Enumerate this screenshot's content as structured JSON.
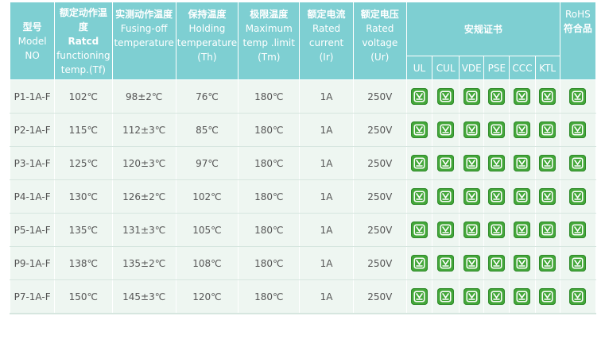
{
  "header": {
    "model": {
      "zh": "型号",
      "en1": "Model",
      "en2": "NO"
    },
    "tf": {
      "zh": "额定动作温度",
      "bold": "Ratcd",
      "en1": "functioning",
      "en2": "temp.(Tf)"
    },
    "fusing": {
      "zh": "实测动作温度",
      "en1": "Fusing-off",
      "en2": "temperature"
    },
    "holding": {
      "zh": "保持温度",
      "en1": "Holding",
      "en2": "temperature",
      "en3": "(Th)"
    },
    "max": {
      "zh": "极限温度",
      "en1": "Maximum",
      "en2": "temp .limit",
      "en3": "(Tm)"
    },
    "current": {
      "zh": "额定电流",
      "en1": "Rated",
      "en2": "current",
      "en3": "(Ir)"
    },
    "voltage": {
      "zh": "额定电压",
      "en1": "Rated",
      "en2": "voltage",
      "en3": "(Ur)"
    },
    "certs_title": "安规证书",
    "certs": [
      "UL",
      "CUL",
      "VDE",
      "PSE",
      "CCC",
      "KTL"
    ],
    "rohs": {
      "en": "RoHS",
      "zh": "符合品"
    }
  },
  "rows": [
    {
      "model": "P1-1A-F",
      "tf": "102℃",
      "fusing": "98±2℃",
      "th": "76℃",
      "tm": "180℃",
      "ir": "1A",
      "ur": "250V"
    },
    {
      "model": "P2-1A-F",
      "tf": "115℃",
      "fusing": "112±3℃",
      "th": "85℃",
      "tm": "180℃",
      "ir": "1A",
      "ur": "250V"
    },
    {
      "model": "P3-1A-F",
      "tf": "125℃",
      "fusing": "120±3℃",
      "th": "97℃",
      "tm": "180℃",
      "ir": "1A",
      "ur": "250V"
    },
    {
      "model": "P4-1A-F",
      "tf": "130℃",
      "fusing": "126±2℃",
      "th": "102℃",
      "tm": "180℃",
      "ir": "1A",
      "ur": "250V"
    },
    {
      "model": "P5-1A-F",
      "tf": "135℃",
      "fusing": "131±3℃",
      "th": "105℃",
      "tm": "180℃",
      "ir": "1A",
      "ur": "250V"
    },
    {
      "model": "P9-1A-F",
      "tf": "138℃",
      "fusing": "135±2℃",
      "th": "108℃",
      "tm": "180℃",
      "ir": "1A",
      "ur": "250V"
    },
    {
      "model": "P7-1A-F",
      "tf": "150℃",
      "fusing": "145±3℃",
      "th": "120℃",
      "tm": "180℃",
      "ir": "1A",
      "ur": "250V"
    }
  ],
  "badge_icon": "check-badge-icon",
  "colors": {
    "header_bg": "#7ecfd2",
    "row_bg": "#eef6f1",
    "badge": "#44a73a"
  }
}
